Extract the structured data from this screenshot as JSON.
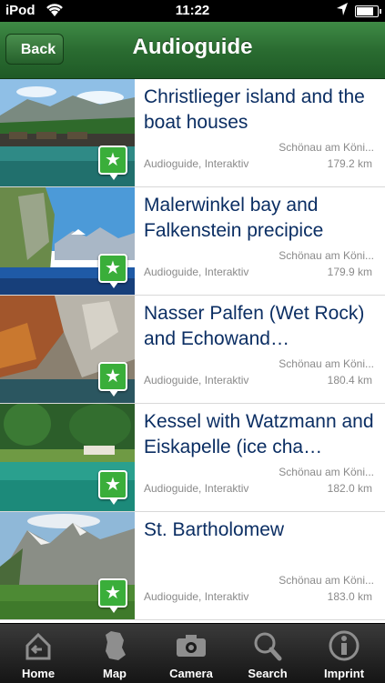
{
  "status": {
    "carrier": "iPod",
    "time": "11:22"
  },
  "nav": {
    "back_label": "Back",
    "title": "Audioguide"
  },
  "items": [
    {
      "title": "Christlieger island and the boat houses",
      "place": "Schönau am Köni...",
      "meta": "Audioguide, Interaktiv",
      "distance": "179.2 km"
    },
    {
      "title": "Malerwinkel bay and Falkenstein precipice",
      "place": "Schönau am Köni...",
      "meta": "Audioguide, Interaktiv",
      "distance": "179.9 km"
    },
    {
      "title": "Nasser Palfen (Wet Rock) and Echowand…",
      "place": "Schönau am Köni...",
      "meta": "Audioguide, Interaktiv",
      "distance": "180.4 km"
    },
    {
      "title": "Kessel with Watzmann and Eiskapelle (ice cha…",
      "place": "Schönau am Köni...",
      "meta": "Audioguide, Interaktiv",
      "distance": "182.0 km"
    },
    {
      "title": "St. Bartholomew",
      "place": "Schönau am Köni...",
      "meta": "Audioguide, Interaktiv",
      "distance": "183.0 km"
    }
  ],
  "tabs": [
    {
      "label": "Home",
      "icon": "home-icon"
    },
    {
      "label": "Map",
      "icon": "map-icon"
    },
    {
      "label": "Camera",
      "icon": "camera-icon"
    },
    {
      "label": "Search",
      "icon": "search-icon"
    },
    {
      "label": "Imprint",
      "icon": "info-icon"
    }
  ],
  "colors": {
    "nav_green": "#2a6c31",
    "title_blue": "#0b2e63",
    "pin_green": "#3aae3a"
  }
}
